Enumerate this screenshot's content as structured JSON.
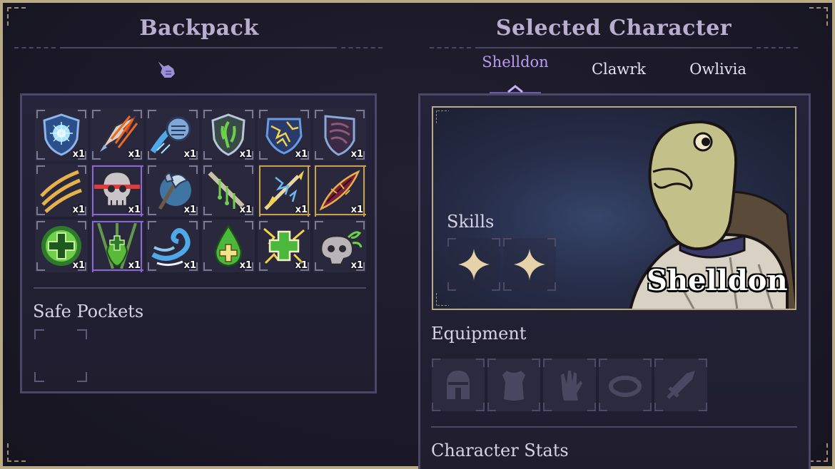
{
  "backpack": {
    "title": "Backpack",
    "items": [
      {
        "icon": "frost-shield-icon",
        "qty": "x1",
        "rarity": "normal"
      },
      {
        "icon": "flaming-arrow-icon",
        "qty": "x1",
        "rarity": "normal"
      },
      {
        "icon": "water-fist-icon",
        "qty": "x1",
        "rarity": "normal"
      },
      {
        "icon": "poison-shield-icon",
        "qty": "x1",
        "rarity": "normal"
      },
      {
        "icon": "lightning-shield-icon",
        "qty": "x1",
        "rarity": "normal"
      },
      {
        "icon": "dark-shield-icon",
        "qty": "x1",
        "rarity": "normal"
      },
      {
        "icon": "claw-slash-icon",
        "qty": "x1",
        "rarity": "normal"
      },
      {
        "icon": "skull-laser-icon",
        "qty": "x1",
        "rarity": "purple"
      },
      {
        "icon": "ice-axe-icon",
        "qty": "x1",
        "rarity": "normal"
      },
      {
        "icon": "dripping-sword-icon",
        "qty": "x1",
        "rarity": "normal"
      },
      {
        "icon": "lightning-spear-icon",
        "qty": "x1",
        "rarity": "gold"
      },
      {
        "icon": "crimson-claw-icon",
        "qty": "x1",
        "rarity": "gold"
      },
      {
        "icon": "healing-orb-icon",
        "qty": "x1",
        "rarity": "normal"
      },
      {
        "icon": "praying-hands-icon",
        "qty": "x1",
        "rarity": "purple"
      },
      {
        "icon": "wind-wave-icon",
        "qty": "x1",
        "rarity": "normal"
      },
      {
        "icon": "healing-drop-icon",
        "qty": "x1",
        "rarity": "normal"
      },
      {
        "icon": "lightning-heal-icon",
        "qty": "x1",
        "rarity": "normal"
      },
      {
        "icon": "poison-skull-icon",
        "qty": "x1",
        "rarity": "normal"
      }
    ],
    "safe_pockets": {
      "title": "Safe Pockets"
    }
  },
  "character": {
    "title": "Selected Character",
    "tabs": [
      {
        "label": "Shelldon",
        "active": true
      },
      {
        "label": "Clawrk",
        "active": false
      },
      {
        "label": "Owlivia",
        "active": false
      }
    ],
    "name": "Shelldon",
    "skills_title": "Skills",
    "skills": [
      {
        "icon": "sparkle-icon"
      },
      {
        "icon": "sparkle-icon"
      }
    ],
    "equipment_title": "Equipment",
    "equipment": [
      {
        "icon": "helmet-icon"
      },
      {
        "icon": "chest-armor-icon"
      },
      {
        "icon": "gauntlet-icon"
      },
      {
        "icon": "ring-icon"
      },
      {
        "icon": "sword-icon"
      }
    ],
    "stats_title": "Character Stats"
  },
  "colors": {
    "frame": "#b9ab86",
    "active_tab": "#b99cf0",
    "section_title": "#b8aed0"
  }
}
